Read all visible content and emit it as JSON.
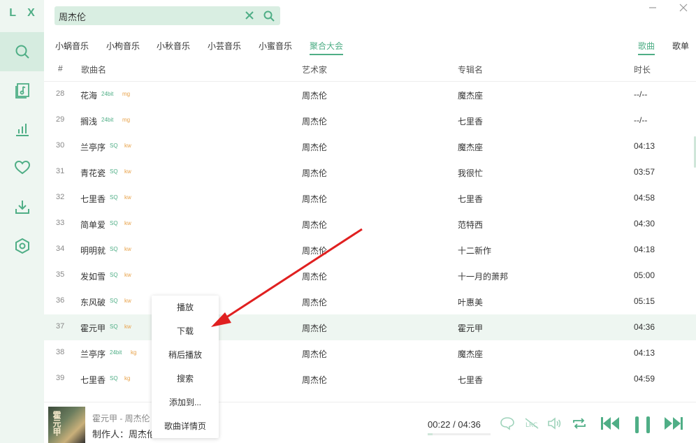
{
  "app": {
    "logo": "L X"
  },
  "sidebar": {
    "items": [
      {
        "icon": "search-icon",
        "active": true
      },
      {
        "icon": "song-list-icon",
        "active": false
      },
      {
        "icon": "leaderboard-icon",
        "active": false
      },
      {
        "icon": "heart-icon",
        "active": false
      },
      {
        "icon": "download-icon",
        "active": false
      },
      {
        "icon": "settings-hexagon-icon",
        "active": false
      }
    ]
  },
  "search": {
    "value": "周杰伦"
  },
  "source_tabs": [
    {
      "label": "小蜗音乐",
      "active": false
    },
    {
      "label": "小枸音乐",
      "active": false
    },
    {
      "label": "小秋音乐",
      "active": false
    },
    {
      "label": "小芸音乐",
      "active": false
    },
    {
      "label": "小蜜音乐",
      "active": false
    },
    {
      "label": "聚合大会",
      "active": true
    }
  ],
  "type_tabs": [
    {
      "label": "歌曲",
      "active": true
    },
    {
      "label": "歌单",
      "active": false
    }
  ],
  "table": {
    "headers": {
      "num": "#",
      "name": "歌曲名",
      "artist": "艺术家",
      "album": "专辑名",
      "duration": "时长"
    },
    "rows": [
      {
        "num": "28",
        "name": "花海",
        "quality": "24bit",
        "source": "mg",
        "artist": "周杰伦",
        "album": "魔杰座",
        "duration": "--/--"
      },
      {
        "num": "29",
        "name": "搁浅",
        "quality": "24bit",
        "source": "mg",
        "artist": "周杰伦",
        "album": "七里香",
        "duration": "--/--"
      },
      {
        "num": "30",
        "name": "兰亭序",
        "quality": "SQ",
        "source": "kw",
        "artist": "周杰伦",
        "album": "魔杰座",
        "duration": "04:13"
      },
      {
        "num": "31",
        "name": "青花瓷",
        "quality": "SQ",
        "source": "kw",
        "artist": "周杰伦",
        "album": "我很忙",
        "duration": "03:57"
      },
      {
        "num": "32",
        "name": "七里香",
        "quality": "SQ",
        "source": "kw",
        "artist": "周杰伦",
        "album": "七里香",
        "duration": "04:58"
      },
      {
        "num": "33",
        "name": "简单爱",
        "quality": "SQ",
        "source": "kw",
        "artist": "周杰伦",
        "album": "范特西",
        "duration": "04:30"
      },
      {
        "num": "34",
        "name": "明明就",
        "quality": "SQ",
        "source": "kw",
        "artist": "周杰伦",
        "album": "十二新作",
        "duration": "04:18"
      },
      {
        "num": "35",
        "name": "发如雪",
        "quality": "SQ",
        "source": "kw",
        "artist": "周杰伦",
        "album": "十一月的萧邦",
        "duration": "05:00"
      },
      {
        "num": "36",
        "name": "东风破",
        "quality": "SQ",
        "source": "kw",
        "artist": "周杰伦",
        "album": "叶惠美",
        "duration": "05:15"
      },
      {
        "num": "37",
        "name": "霍元甲",
        "quality": "SQ",
        "source": "kw",
        "artist": "周杰伦",
        "album": "霍元甲",
        "duration": "04:36"
      },
      {
        "num": "38",
        "name": "兰亭序",
        "quality": "24bit",
        "source": "kg",
        "artist": "周杰伦",
        "album": "魔杰座",
        "duration": "04:13"
      },
      {
        "num": "39",
        "name": "七里香",
        "quality": "SQ",
        "source": "kg",
        "artist": "周杰伦",
        "album": "七里香",
        "duration": "04:59"
      }
    ]
  },
  "context_menu": {
    "items": [
      "播放",
      "下载",
      "稍后播放",
      "搜索",
      "添加到...",
      "歌曲详情页"
    ]
  },
  "player": {
    "title": "霍元甲 - 周杰伦",
    "maker": "制作人：周杰伦",
    "cover_text": "霍元甲",
    "time": "00:22 / 04:36",
    "progress": 0.08
  },
  "colors": {
    "accent": "#4fae86",
    "sidebar_bg": "#eef6f1",
    "arrow": "#e02020"
  }
}
